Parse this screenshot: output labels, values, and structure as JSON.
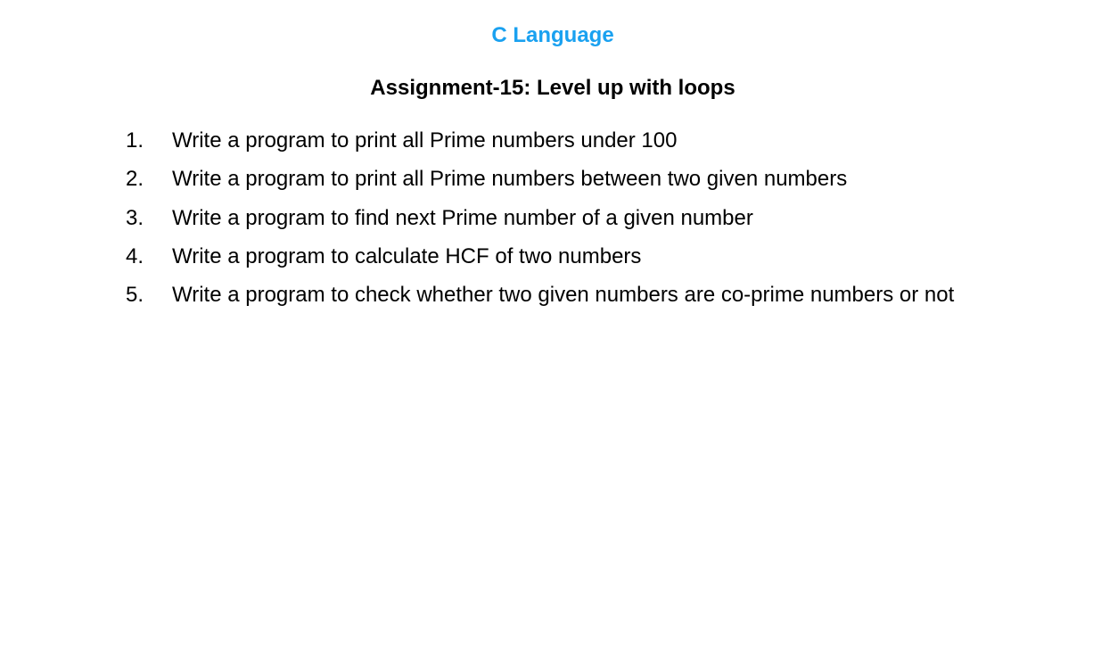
{
  "header": {
    "course_title": "C Language",
    "assignment_title": "Assignment-15: Level up with loops"
  },
  "colors": {
    "course_title": "#1aa1f0",
    "text": "#000000",
    "background": "#ffffff"
  },
  "questions": [
    {
      "number": "1.",
      "text": "Write a program to print all Prime numbers under 100"
    },
    {
      "number": "2.",
      "text": "Write a program to print all Prime numbers between two given numbers"
    },
    {
      "number": "3.",
      "text": "Write a program to find next Prime number of a given number"
    },
    {
      "number": "4.",
      "text": "Write a program to calculate HCF of two numbers"
    },
    {
      "number": "5.",
      "text": "Write a program to check whether two given numbers are co-prime numbers or not"
    }
  ]
}
